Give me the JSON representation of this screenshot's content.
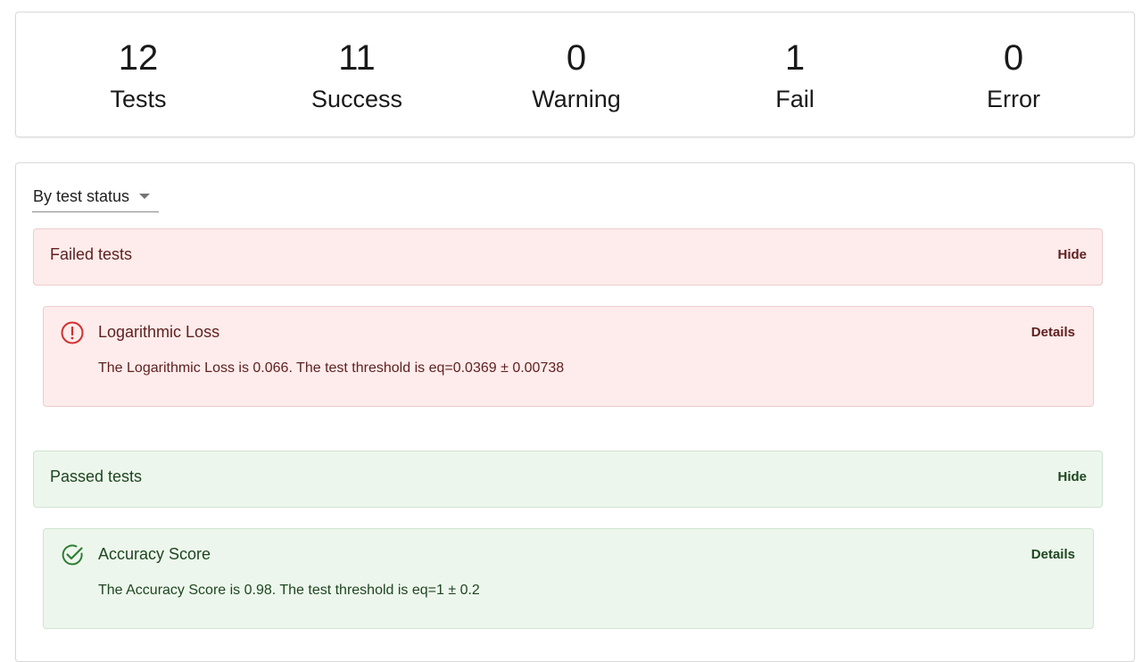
{
  "summary": {
    "stats": [
      {
        "value": "12",
        "label": "Tests"
      },
      {
        "value": "11",
        "label": "Success"
      },
      {
        "value": "0",
        "label": "Warning"
      },
      {
        "value": "1",
        "label": "Fail"
      },
      {
        "value": "0",
        "label": "Error"
      }
    ]
  },
  "filter": {
    "selected": "By test status"
  },
  "groups": {
    "failed": {
      "title": "Failed tests",
      "hide_label": "Hide",
      "color": "#fdeceb",
      "text_color": "#5f2120",
      "icon": "error-circle-icon",
      "tests": [
        {
          "name": "Logarithmic Loss",
          "details_label": "Details",
          "description": "The Logarithmic Loss is 0.066. The test threshold is eq=0.0369 ± 0.00738"
        }
      ]
    },
    "passed": {
      "title": "Passed tests",
      "hide_label": "Hide",
      "color": "#edf6ed",
      "text_color": "#1e4620",
      "icon": "check-circle-icon",
      "tests": [
        {
          "name": "Accuracy Score",
          "details_label": "Details",
          "description": "The Accuracy Score is 0.98. The test threshold is eq=1 ± 0.2"
        }
      ]
    }
  }
}
